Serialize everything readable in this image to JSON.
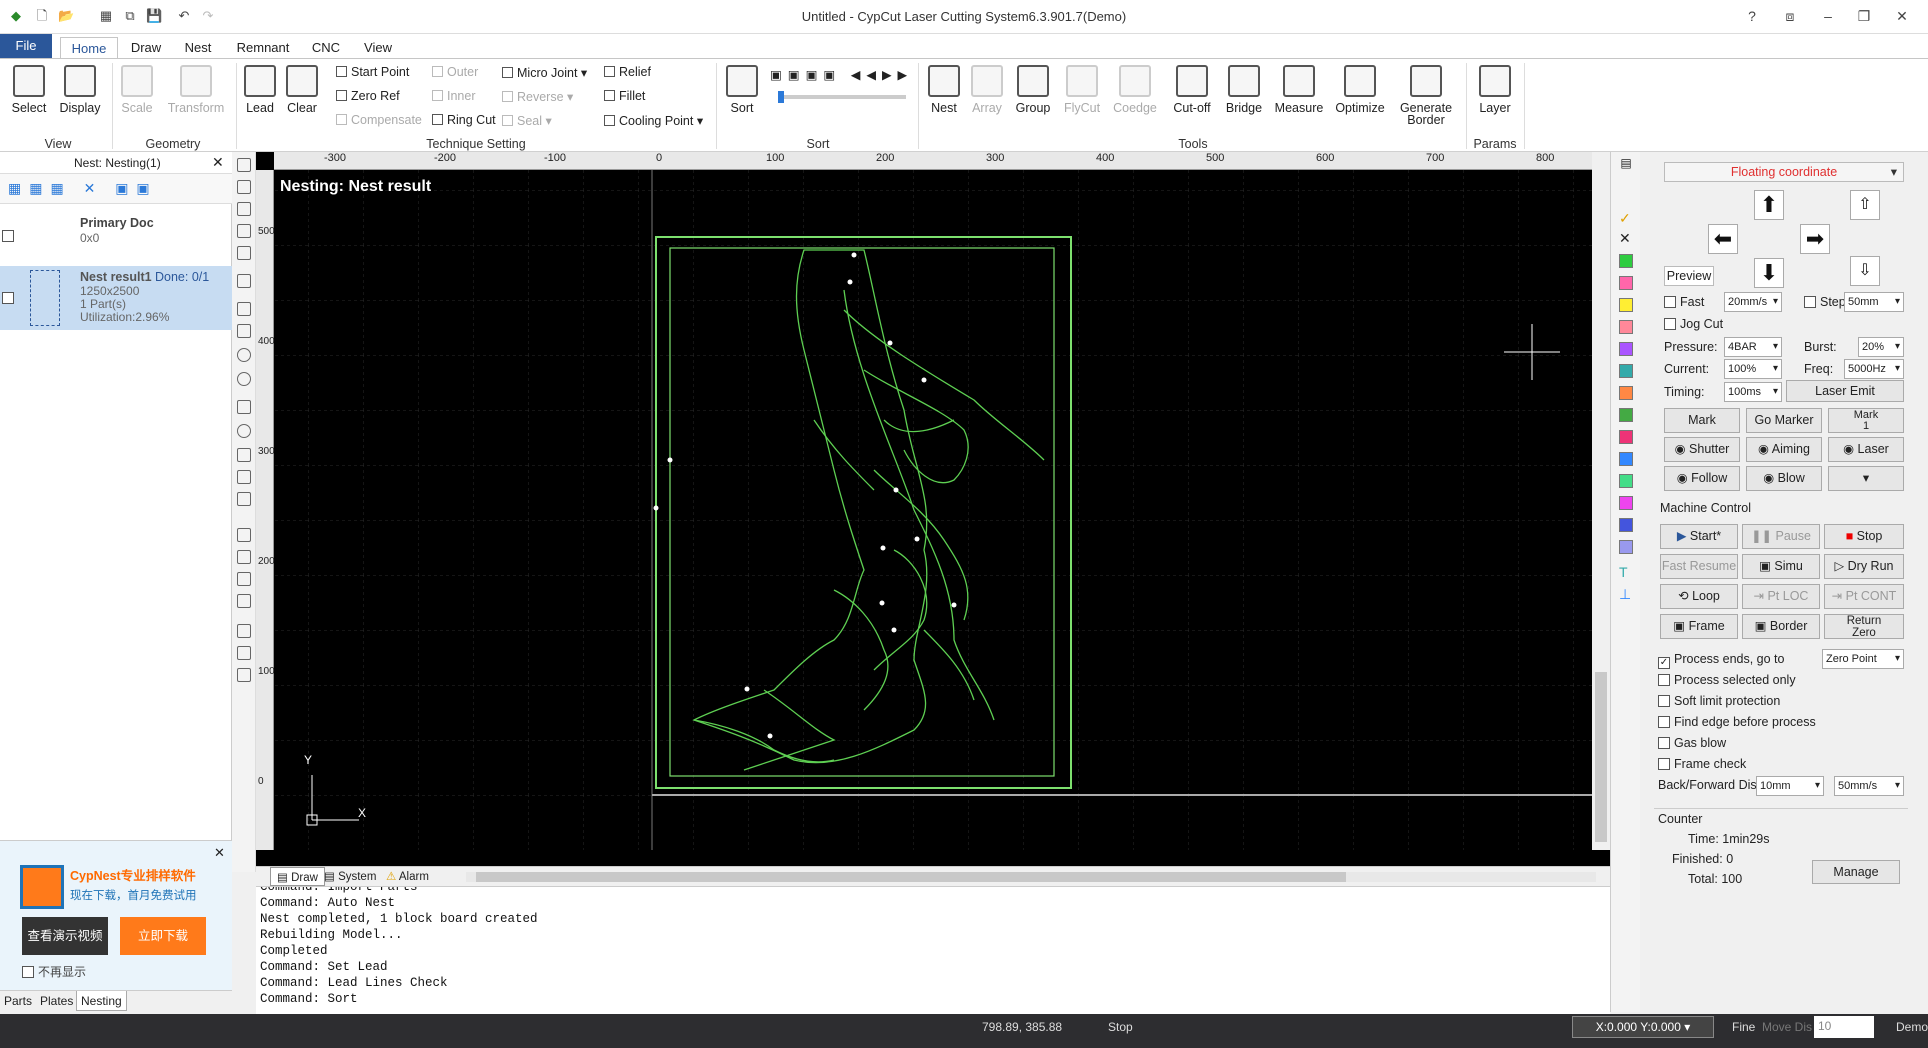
{
  "app": {
    "title": "Untitled - CypCut Laser Cutting System6.3.901.7(Demo)"
  },
  "tabs": {
    "file": "File",
    "home": "Home",
    "draw": "Draw",
    "nest": "Nest",
    "remnant": "Remnant",
    "cnc": "CNC",
    "view": "View"
  },
  "ribbon": {
    "select": "Select",
    "display": "Display",
    "scale": "Scale",
    "transform": "Transform",
    "lead": "Lead",
    "clear": "Clear",
    "start_point": "Start Point",
    "zero_ref": "Zero Ref",
    "compensate": "Compensate",
    "outer": "Outer",
    "inner": "Inner",
    "ring_cut": "Ring Cut",
    "micro_joint": "Micro Joint",
    "reverse": "Reverse",
    "seal": "Seal",
    "relief": "Relief",
    "fillet": "Fillet",
    "cooling_point": "Cooling Point",
    "sort": "Sort",
    "nest": "Nest",
    "array": "Array",
    "group": "Group",
    "flycut": "FlyCut",
    "coedge": "Coedge",
    "cutoff": "Cut-off",
    "bridge": "Bridge",
    "measure": "Measure",
    "optimize": "Optimize",
    "generate_border_1": "Generate",
    "generate_border_2": "Border",
    "layer": "Layer",
    "groups": {
      "view": "View",
      "geometry": "Geometry",
      "technique": "Technique Setting",
      "sort": "Sort",
      "tools": "Tools",
      "params": "Params"
    }
  },
  "left_panel": {
    "header": "Nest: Nesting(1)",
    "primary_doc": {
      "name": "Primary Doc",
      "size": "0x0"
    },
    "nest_result": {
      "name": "Nest result1",
      "done": "Done: 0/1",
      "size": "1250x2500",
      "parts": "1 Part(s)",
      "utilization": "Utilization:2.96%"
    },
    "promo": {
      "title": "CypNest专业排样软件",
      "subtitle": "现在下载，首月免费试用",
      "video_btn": "查看演示视频",
      "download_btn": "立即下载",
      "hide": "不再显示"
    },
    "tabs": {
      "parts": "Parts",
      "plates": "Plates",
      "nesting": "Nesting"
    }
  },
  "canvas": {
    "overlay_title": "Nesting: Nest result",
    "axis_y": "Y",
    "axis_x": "X",
    "ruler_h": [
      "-300",
      "-200",
      "-100",
      "0",
      "100",
      "200",
      "300",
      "400",
      "500",
      "600",
      "700",
      "800"
    ],
    "ruler_v": [
      "500",
      "400",
      "300",
      "200",
      "100",
      "0"
    ]
  },
  "bottom_tabs": {
    "draw": "Draw",
    "system": "System",
    "alarm": "Alarm"
  },
  "console": {
    "lines": [
      "Command: Import Parts",
      "Command: Auto Nest",
      "Nest completed, 1 block board created",
      "Rebuilding Model...",
      "Completed",
      "Command: Set Lead",
      "Command: Lead Lines Check",
      "Command: Sort"
    ]
  },
  "right_panel": {
    "coord_mode": "Floating coordinate",
    "preview": "Preview",
    "fast": "Fast",
    "fast_speed": "20mm/s",
    "step": "Step",
    "step_value": "50mm",
    "jog_cut": "Jog Cut",
    "pressure_label": "Pressure:",
    "pressure": "4BAR",
    "burst_label": "Burst:",
    "burst": "20%",
    "current_label": "Current:",
    "current": "100%",
    "freq_label": "Freq:",
    "freq": "5000Hz",
    "timing_label": "Timing:",
    "timing": "100ms",
    "laser_emit": "Laser Emit",
    "mark": "Mark",
    "go_marker": "Go Marker",
    "mark1_a": "Mark",
    "mark1_b": "1",
    "shutter": "Shutter",
    "aiming": "Aiming",
    "laser": "Laser",
    "follow": "Follow",
    "blow": "Blow",
    "machine_control": "Machine Control",
    "start": "Start*",
    "pause": "Pause",
    "stop": "Stop",
    "fast_resume": "Fast Resume",
    "simu": "Simu",
    "dry_run": "Dry Run",
    "loop": "Loop",
    "pt_loc": "Pt LOC",
    "pt_cont": "Pt CONT",
    "frame": "Frame",
    "border": "Border",
    "return_zero_1": "Return",
    "return_zero_2": "Zero",
    "process_ends": "Process ends, go to",
    "zero_point": "Zero Point",
    "process_selected": "Process selected only",
    "soft_limit": "Soft limit protection",
    "find_edge": "Find edge before process",
    "gas_blow": "Gas blow",
    "frame_check": "Frame check",
    "back_forward": "Back/Forward Dis:",
    "bf_dist": "10mm",
    "bf_speed": "50mm/s",
    "counter": "Counter",
    "time": "Time: 1min29s",
    "finished": "Finished: 0",
    "total": "Total: 100",
    "manage": "Manage"
  },
  "layer_colors": [
    "#2ecc40",
    "#ff66aa",
    "#ffee33",
    "#ff8899",
    "#aa55ff",
    "#33aaaa",
    "#ff8844",
    "#44aa44",
    "#ee3377",
    "#3388ff",
    "#44dd88",
    "#ee44ee",
    "#4455dd",
    "#9999ee"
  ],
  "status": {
    "coords": "798.89, 385.88",
    "state": "Stop",
    "xy": "X:0.000 Y:0.000",
    "fine": "Fine",
    "move_dist": "Move Dis",
    "move_value": "10",
    "demo": "Demo"
  }
}
